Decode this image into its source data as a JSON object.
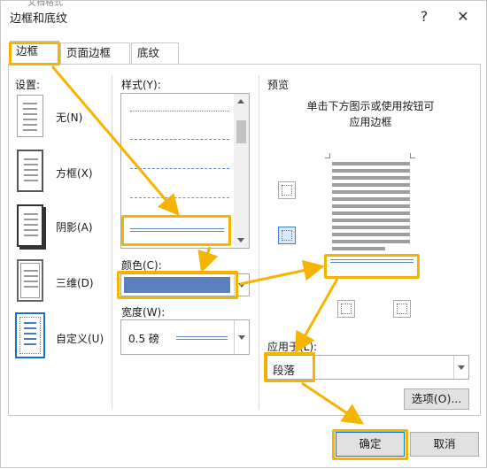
{
  "window": {
    "title": "边框和底纹",
    "help": "?",
    "close": "✕",
    "bg_text": "文档格式"
  },
  "tabs": [
    {
      "label": "边框(B)"
    },
    {
      "label": "页面边框(P)"
    },
    {
      "label": "底纹(S)"
    }
  ],
  "settings": {
    "label": "设置:",
    "items": [
      {
        "label": "无(N)"
      },
      {
        "label": "方框(X)"
      },
      {
        "label": "阴影(A)"
      },
      {
        "label": "三维(D)"
      },
      {
        "label": "自定义(U)"
      }
    ]
  },
  "style": {
    "label": "样式(Y):"
  },
  "color": {
    "label": "颜色(C):",
    "value_color": "#5b7fbf"
  },
  "width": {
    "label": "宽度(W):",
    "value": "0.5 磅"
  },
  "preview": {
    "label": "预览",
    "hint_line1": "单击下方图示或使用按钮可",
    "hint_line2": "应用边框"
  },
  "apply_to": {
    "label": "应用于(L):",
    "value": "段落"
  },
  "options_button": "选项(O)...",
  "ok_button": "确定",
  "cancel_button": "取消",
  "colors": {
    "highlight": "#f4b400",
    "border_line": "#5b87c4"
  }
}
